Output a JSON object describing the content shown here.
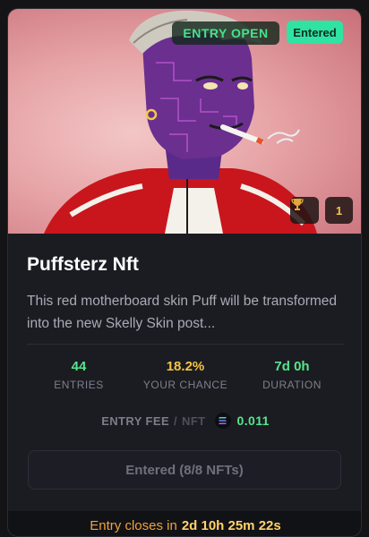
{
  "card": {
    "status_badge": "ENTRY OPEN",
    "entered_badge": "Entered",
    "icon": "trophy-icon",
    "winners_count": "1",
    "title": "Puffsterz Nft",
    "description": "This red motherboard skin Puff will be transformed into the new Skelly Skin post...",
    "stats": [
      {
        "value": "44",
        "label": "ENTRIES",
        "color": "#57e58c"
      },
      {
        "value": "18.2%",
        "label": "YOUR CHANCE",
        "color": "#f5c542"
      },
      {
        "value": "7d 0h",
        "label": "DURATION",
        "color": "#57e58c"
      }
    ],
    "fee": {
      "label": "ENTRY FEE",
      "unit": "NFT",
      "currency_icon": "solana-icon",
      "amount": "0.011"
    },
    "button_label": "Entered (8/8 NFTs)",
    "footer": {
      "label": "Entry closes in",
      "time": "2d 10h 25m 22s"
    }
  },
  "colors": {
    "accent_green": "#2fe3a2",
    "warning": "#f0a13a"
  }
}
